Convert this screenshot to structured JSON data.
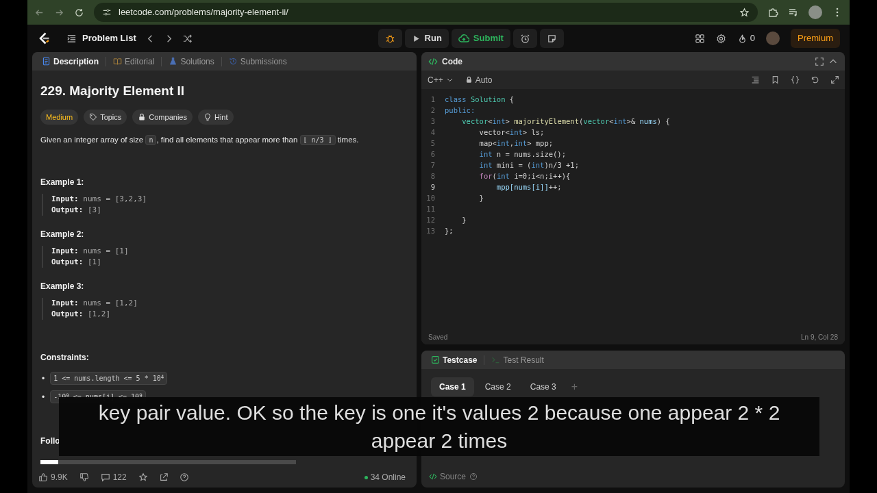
{
  "browser": {
    "url": "leetcode.com/problems/majority-element-ii/"
  },
  "header": {
    "problem_list": "Problem List",
    "run": "Run",
    "submit": "Submit",
    "streak": "0",
    "premium": "Premium"
  },
  "left_tabs": [
    {
      "label": "Description",
      "selected": true,
      "kind": "document"
    },
    {
      "label": "Editorial",
      "selected": false,
      "kind": "book"
    },
    {
      "label": "Solutions",
      "selected": false,
      "kind": "flask"
    },
    {
      "label": "Submissions",
      "selected": false,
      "kind": "history"
    }
  ],
  "problem": {
    "title": "229. Majority Element II",
    "difficulty": "Medium",
    "chips": [
      {
        "label": "Topics",
        "kind": "tag"
      },
      {
        "label": "Companies",
        "kind": "lock"
      },
      {
        "label": "Hint",
        "kind": "bulb"
      }
    ],
    "statement": [
      {
        "kind": "text",
        "text": "Given an integer array of size "
      },
      {
        "kind": "code",
        "text": "n"
      },
      {
        "kind": "text",
        "text": ", find all elements that appear more than "
      },
      {
        "kind": "code",
        "text": "⌊ n/3 ⌋"
      },
      {
        "kind": "text",
        "text": " times."
      }
    ],
    "examples": [
      {
        "title": "Example 1:",
        "input_label": "Input:",
        "input": "nums = [3,2,3]",
        "output_label": "Output:",
        "output": "[3]"
      },
      {
        "title": "Example 2:",
        "input_label": "Input:",
        "input": "nums = [1]",
        "output_label": "Output:",
        "output": "[1]"
      },
      {
        "title": "Example 3:",
        "input_label": "Input:",
        "input": "nums = [1,2]",
        "output_label": "Output:",
        "output": "[1,2]"
      }
    ],
    "constraints_title": "Constraints:",
    "constraints": [
      {
        "bullet": "•",
        "text": "1 <= nums.length <= 5 * 10$^{4}$"
      },
      {
        "bullet": "•",
        "text": "-10$^{9}$ <= nums[i] <= 10$^{9}$"
      }
    ],
    "follow_up": "Follo"
  },
  "video": {
    "progress": {
      "level": 0.07
    },
    "caption": "key pair value. OK so the key is one it's values 2 because one appear 2 * 2 appear 2 times"
  },
  "footer": {
    "likes": "9.9K",
    "comments": "122",
    "online": "34 Online"
  },
  "editor": {
    "title": "Code",
    "language": "C++",
    "mode": "Auto",
    "status": "Saved",
    "position": "Ln 9, Col 28",
    "lines": [
      {
        "number": "1",
        "selected": false,
        "tokens": [
          {
            "kind": "kw",
            "text": "class"
          },
          {
            "kind": "type",
            "text": " Solution"
          },
          {
            "kind": "txt",
            "text": " {"
          }
        ]
      },
      {
        "number": "2",
        "selected": false,
        "tokens": [
          {
            "kind": "kw",
            "text": "public:"
          }
        ]
      },
      {
        "number": "3",
        "selected": false,
        "tokens": [
          {
            "kind": "type",
            "text": "    vector"
          },
          {
            "kind": "txt",
            "text": "<"
          },
          {
            "kind": "kw",
            "text": "int"
          },
          {
            "kind": "txt",
            "text": "> "
          },
          {
            "kind": "fn",
            "text": "majorityElement"
          },
          {
            "kind": "txt",
            "text": "("
          },
          {
            "kind": "type",
            "text": "vector"
          },
          {
            "kind": "txt",
            "text": "<"
          },
          {
            "kind": "kw",
            "text": "int"
          },
          {
            "kind": "txt",
            "text": ">& "
          },
          {
            "kind": "var",
            "text": "nums"
          },
          {
            "kind": "txt",
            "text": ") {"
          }
        ]
      },
      {
        "number": "4",
        "selected": false,
        "tokens": [
          {
            "kind": "txt",
            "text": "        vector<"
          },
          {
            "kind": "kw",
            "text": "int"
          },
          {
            "kind": "txt",
            "text": "> ls;"
          }
        ]
      },
      {
        "number": "5",
        "selected": false,
        "tokens": [
          {
            "kind": "txt",
            "text": "        map<"
          },
          {
            "kind": "kw",
            "text": "int"
          },
          {
            "kind": "txt",
            "text": ","
          },
          {
            "kind": "kw",
            "text": "int"
          },
          {
            "kind": "txt",
            "text": "> mpp;"
          }
        ]
      },
      {
        "number": "6",
        "selected": false,
        "tokens": [
          {
            "kind": "kw",
            "text": "        int"
          },
          {
            "kind": "txt",
            "text": " n = nums.size();"
          }
        ]
      },
      {
        "number": "7",
        "selected": false,
        "tokens": [
          {
            "kind": "kw",
            "text": "        int"
          },
          {
            "kind": "txt",
            "text": " mini = ("
          },
          {
            "kind": "kw",
            "text": "int"
          },
          {
            "kind": "txt",
            "text": ")n/3 +1;"
          }
        ]
      },
      {
        "number": "8",
        "selected": false,
        "tokens": [
          {
            "kind": "ctrl",
            "text": "        for"
          },
          {
            "kind": "txt",
            "text": "("
          },
          {
            "kind": "kw",
            "text": "int"
          },
          {
            "kind": "txt",
            "text": " i=0;i<n;i++){"
          }
        ]
      },
      {
        "number": "9",
        "selected": true,
        "tokens": [
          {
            "kind": "var",
            "text": "            mpp[nums[i]]"
          },
          {
            "kind": "txt",
            "text": "++;"
          }
        ]
      },
      {
        "number": "10",
        "selected": false,
        "tokens": [
          {
            "kind": "txt",
            "text": "        }"
          }
        ]
      },
      {
        "number": "11",
        "selected": false
      },
      {
        "number": "12",
        "selected": false,
        "tokens": [
          {
            "kind": "txt",
            "text": "    }"
          }
        ]
      },
      {
        "number": "13",
        "selected": false,
        "tokens": [
          {
            "kind": "txt",
            "text": "};"
          }
        ]
      }
    ]
  },
  "testcase": {
    "tabs": [
      {
        "label": "Testcase",
        "selected": true,
        "kind": "check"
      },
      {
        "label": "Test Result",
        "selected": false,
        "kind": "terminal"
      }
    ],
    "cases": [
      {
        "label": "Case 1",
        "selected": true
      },
      {
        "label": "Case 2",
        "selected": false
      },
      {
        "label": "Case 3",
        "selected": false
      }
    ],
    "add": "+",
    "source": "Source"
  }
}
